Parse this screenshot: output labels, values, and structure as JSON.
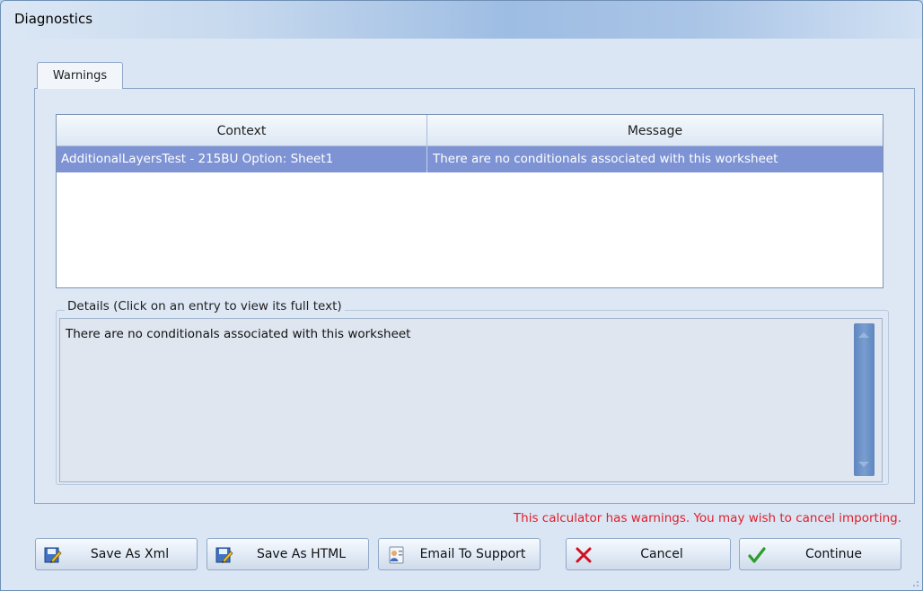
{
  "window": {
    "title": "Diagnostics"
  },
  "tabs": [
    {
      "label": "Warnings",
      "selected": true
    }
  ],
  "grid": {
    "columns": [
      "Context",
      "Message"
    ],
    "rows": [
      {
        "context": "AdditionalLayersTest - 215BU  Option: Sheet1",
        "message": "There are no conditionals associated with this worksheet",
        "selected": true
      }
    ]
  },
  "details": {
    "legend": "Details (Click on an entry to view its full text)",
    "text": "There are no conditionals associated with this worksheet"
  },
  "status": {
    "warning_text": "This calculator has warnings. You may wish to cancel importing.",
    "warning_color": "#e11d2a"
  },
  "buttons": {
    "save_xml": {
      "label": "Save As Xml",
      "icon": "save-edit-icon"
    },
    "save_html": {
      "label": "Save As HTML",
      "icon": "save-edit-icon"
    },
    "email": {
      "label": "Email To Support",
      "icon": "contact-card-icon"
    },
    "cancel": {
      "label": "Cancel",
      "icon": "red-x-icon"
    },
    "continue": {
      "label": "Continue",
      "icon": "green-check-icon"
    }
  },
  "colors": {
    "selection": "#7e93d4",
    "accent": "#6f8fb5"
  }
}
